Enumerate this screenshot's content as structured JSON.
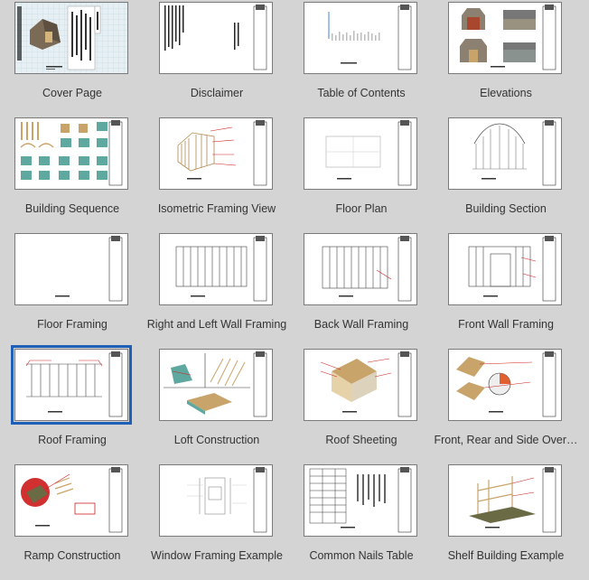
{
  "pages": [
    {
      "label": "Cover Page",
      "selected": false
    },
    {
      "label": "Disclaimer",
      "selected": false
    },
    {
      "label": "Table of Contents",
      "selected": false
    },
    {
      "label": "Elevations",
      "selected": false
    },
    {
      "label": "Building Sequence",
      "selected": false
    },
    {
      "label": "Isometric Framing View",
      "selected": false
    },
    {
      "label": "Floor Plan",
      "selected": false
    },
    {
      "label": "Building Section",
      "selected": false
    },
    {
      "label": "Floor Framing",
      "selected": false
    },
    {
      "label": "Right and Left Wall Framing",
      "selected": false
    },
    {
      "label": "Back Wall Framing",
      "selected": false
    },
    {
      "label": "Front Wall Framing",
      "selected": false
    },
    {
      "label": "Roof Framing",
      "selected": true
    },
    {
      "label": "Loft Construction",
      "selected": false
    },
    {
      "label": "Roof Sheeting",
      "selected": false
    },
    {
      "label": "Front, Rear and Side Over…",
      "selected": false
    },
    {
      "label": "Ramp Construction",
      "selected": false
    },
    {
      "label": "Window Framing Example",
      "selected": false
    },
    {
      "label": "Common Nails Table",
      "selected": false
    },
    {
      "label": "Shelf Building Example",
      "selected": false
    }
  ],
  "colors": {
    "background": "#d4d4d4",
    "selection": "#1f5fb8",
    "annotation": "#cc2222",
    "wood": "#c9a46a",
    "panel": "#5fa8a0"
  }
}
